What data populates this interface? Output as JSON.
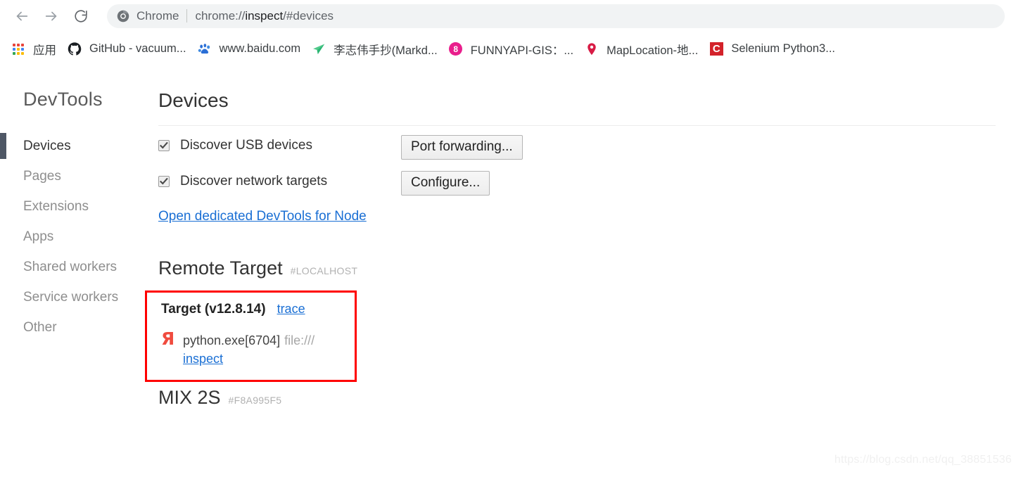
{
  "browser": {
    "back_icon": "arrow-left-icon",
    "forward_icon": "arrow-right-icon",
    "reload_icon": "reload-icon",
    "omnibox": {
      "chrome_icon": "chrome-logo-icon",
      "app_name": "Chrome",
      "url_prefix": "chrome://",
      "url_strong": "inspect",
      "url_suffix": "/#devices",
      "url_full": "chrome://inspect/#devices"
    },
    "bookmarks": [
      {
        "icon": "apps-grid-icon",
        "label": "应用"
      },
      {
        "icon": "github-icon",
        "label": "GitHub - vacuum..."
      },
      {
        "icon": "baidu-paw-icon",
        "label": "www.baidu.com"
      },
      {
        "icon": "paper-plane-icon",
        "label": "李志伟手抄(Markd..."
      },
      {
        "icon": "pink-badge-8-icon",
        "label": "FUNNYAPI-GIS：..."
      },
      {
        "icon": "map-pin-icon",
        "label": "MapLocation-地..."
      },
      {
        "icon": "csdn-c-icon",
        "label": "Selenium Python3..."
      }
    ]
  },
  "devtools": {
    "brand": "DevTools",
    "nav": [
      {
        "label": "Devices",
        "active": true
      },
      {
        "label": "Pages",
        "active": false
      },
      {
        "label": "Extensions",
        "active": false
      },
      {
        "label": "Apps",
        "active": false
      },
      {
        "label": "Shared workers",
        "active": false
      },
      {
        "label": "Service workers",
        "active": false
      },
      {
        "label": "Other",
        "active": false
      }
    ],
    "page_title": "Devices",
    "discovery": [
      {
        "label": "Discover USB devices",
        "checked": true,
        "button": "Port forwarding..."
      },
      {
        "label": "Discover network targets",
        "checked": true,
        "button": "Configure..."
      }
    ],
    "node_link": "Open dedicated DevTools for Node",
    "remote_target": {
      "title": "Remote Target",
      "id": "#LOCALHOST",
      "target": {
        "title": "Target (v12.8.14)",
        "trace_link": "trace",
        "icon": "yandex-ya-icon",
        "process_name": "python.exe[6704]",
        "url": "file:///",
        "inspect_link": "inspect"
      },
      "highlight_color": "#ff0000"
    },
    "device": {
      "title": "MIX 2S",
      "id": "#F8A995F5"
    }
  },
  "watermark": "https://blog.csdn.net/qq_38851536",
  "colors": {
    "link": "#1a6fd4",
    "sidebar_selection": "#4e5765",
    "accent_red": "#f04b3e",
    "omnibox_bg": "#f1f3f4"
  }
}
